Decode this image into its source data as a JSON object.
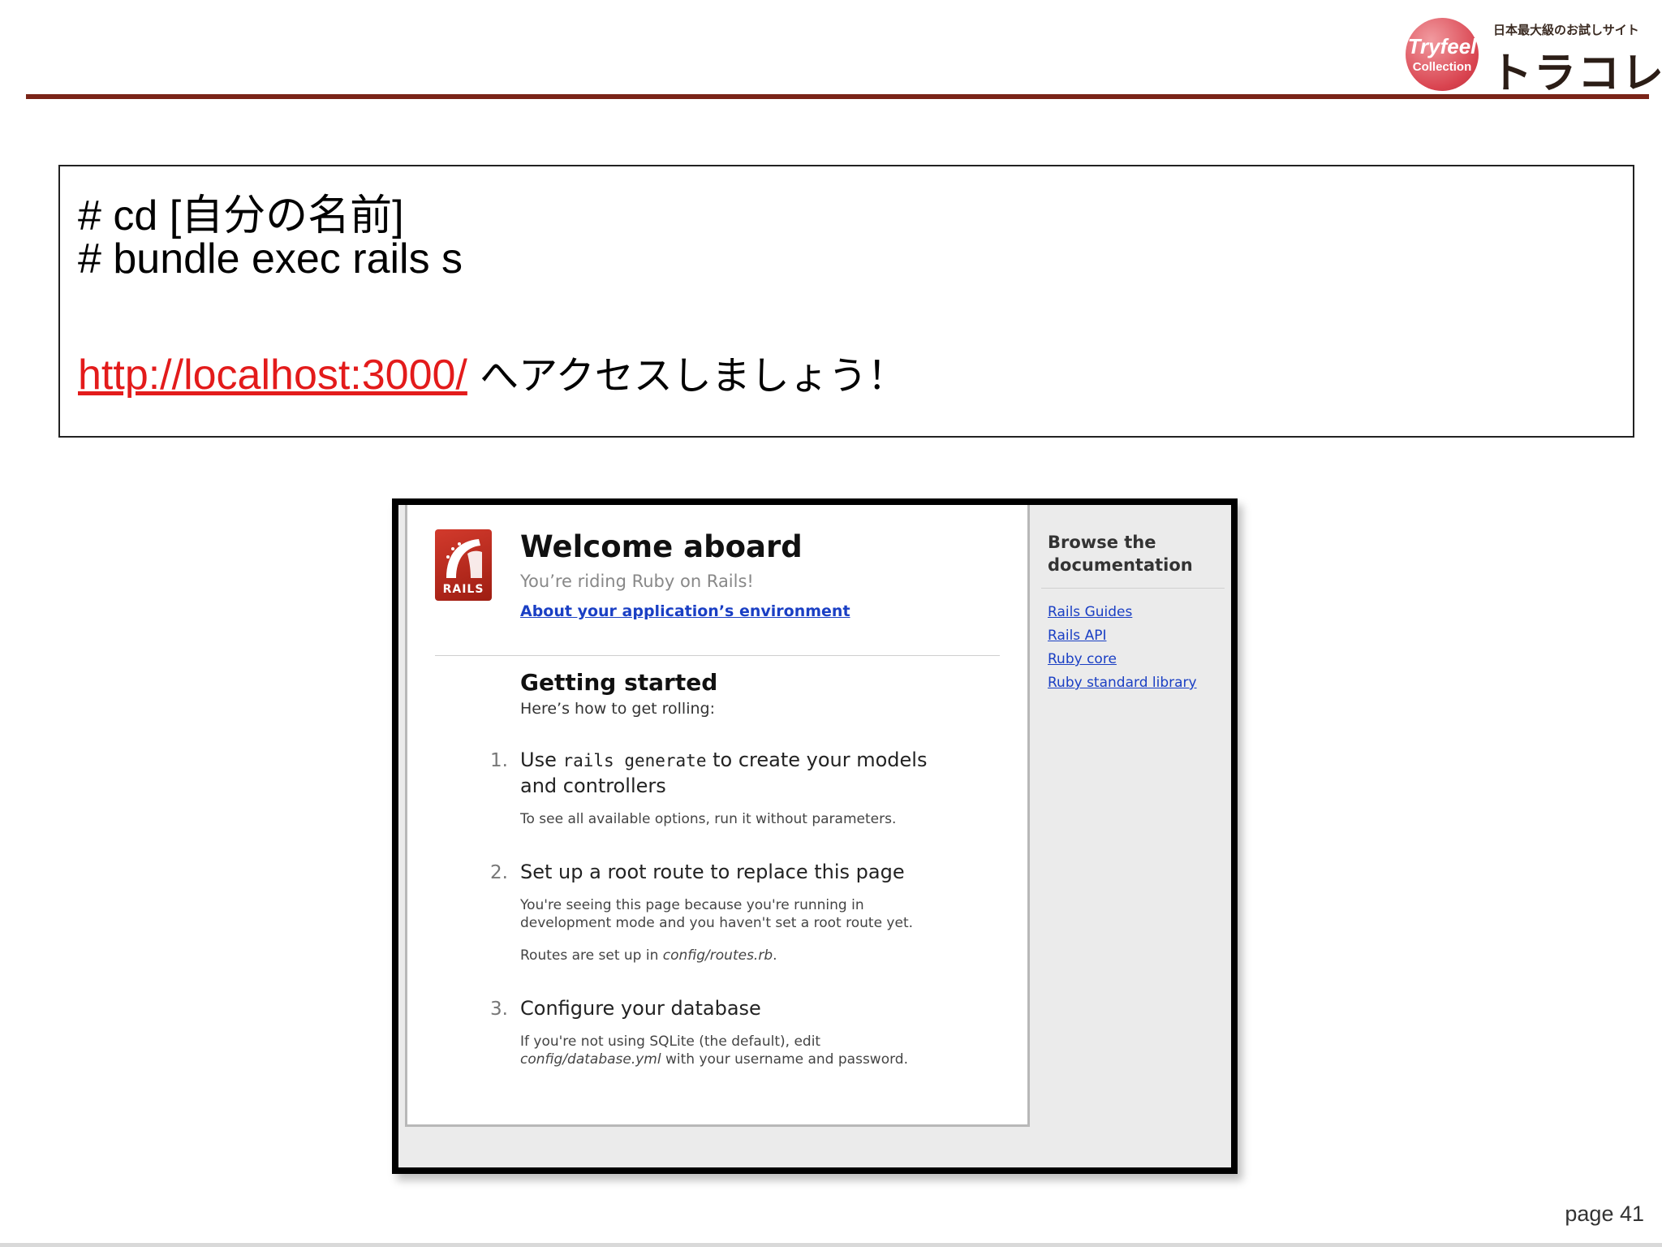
{
  "header": {
    "logo_circle_line1": "Tryfeel",
    "logo_circle_line2": "Collection",
    "logo_tagline": "日本最大級のお試しサイト",
    "logo_name": "トラコレ"
  },
  "instructions": {
    "command1": "# cd [自分の名前]",
    "command2": "# bundle exec rails s",
    "url": "http://localhost:3000/",
    "url_suffix": " へアクセスしましょう！"
  },
  "screenshot": {
    "logo_text": "RAILS",
    "title": "Welcome aboard",
    "subtitle": "You’re riding Ruby on Rails!",
    "env_link": "About your application’s environment",
    "getting_started_title": "Getting started",
    "getting_started_sub": "Here’s how to get rolling:",
    "steps": [
      {
        "num": "1.",
        "title_before": "Use ",
        "title_code": "rails generate",
        "title_after": " to create your models",
        "title_line2": "and controllers",
        "text1": "To see all available options, run it without parameters."
      },
      {
        "num": "2.",
        "title": "Set up a root route to replace this page",
        "text1_line1": "You're seeing this page because you're running in",
        "text1_line2": "development mode and you haven't set a root route yet.",
        "text2_before": "Routes are set up in ",
        "text2_italic": "config/routes.rb",
        "text2_after": "."
      },
      {
        "num": "3.",
        "title": "Configure your database",
        "text1_line1": "If you're not using SQLite (the default), edit",
        "text1_italic": "config/database.yml",
        "text1_after": " with your username and password."
      }
    ],
    "sidebar": {
      "title_line1": "Browse the",
      "title_line2": "documentation",
      "links": [
        "Rails Guides",
        "Rails API",
        "Ruby core",
        "Ruby standard library"
      ]
    }
  },
  "footer": {
    "page_number": "page 41"
  }
}
